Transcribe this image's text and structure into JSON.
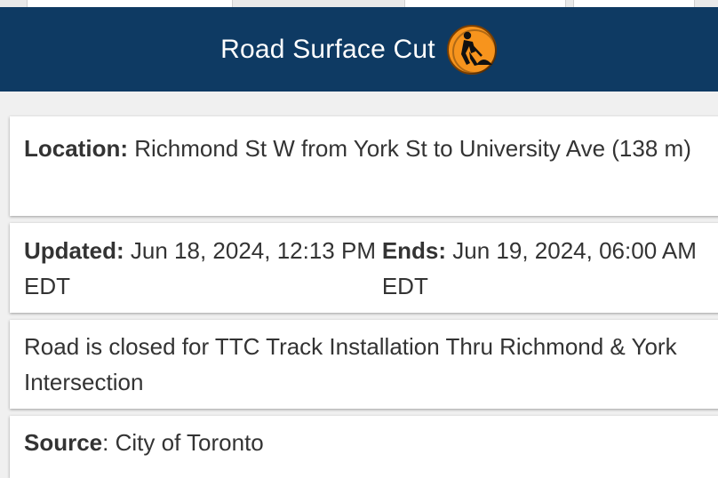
{
  "header": {
    "title": "Road Surface Cut",
    "icon": "road-work-icon",
    "background_color": "#0e3a63",
    "icon_color": "#f7941d"
  },
  "location": {
    "label": "Location:",
    "value": " Richmond St W from York St to University Ave (138 m)"
  },
  "times": {
    "updated_label": "Updated:",
    "updated_value": " Jun 18, 2024, 12:13 PM EDT",
    "ends_label": "Ends:",
    "ends_value": " Jun 19, 2024, 06:00 AM EDT"
  },
  "description": "Road is closed for TTC Track Installation Thru Richmond & York Intersection",
  "source": {
    "label": "Source",
    "value": ": City of Toronto"
  }
}
